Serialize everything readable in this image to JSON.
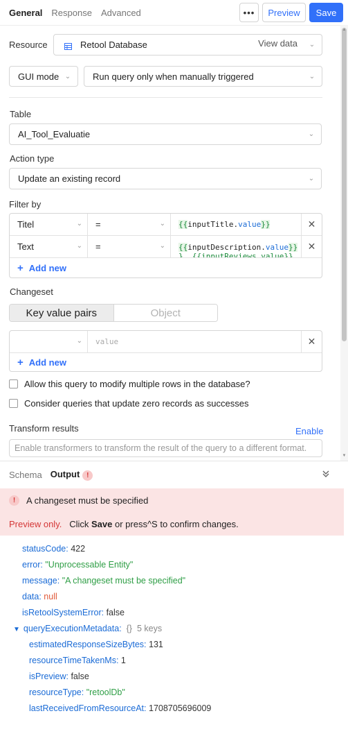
{
  "tabs": [
    "General",
    "Response",
    "Advanced"
  ],
  "toolbar": {
    "more": "•••",
    "preview": "Preview",
    "save": "Save"
  },
  "resource": {
    "label": "Resource",
    "value": "Retool Database",
    "view_data": "View data",
    "icon": "table-icon"
  },
  "mode": {
    "value": "GUI mode",
    "trigger": "Run query only when manually triggered"
  },
  "table": {
    "label": "Table",
    "value": "AI_Tool_Evaluatie"
  },
  "action": {
    "label": "Action type",
    "value": "Update an existing record"
  },
  "filter": {
    "label": "Filter by",
    "rows": [
      {
        "column": "Titel",
        "operator": "=",
        "open": "{{",
        "var": "inputTitle",
        "dot": ".",
        "prop": "value",
        "close": "}}"
      },
      {
        "column": "Text",
        "operator": "=",
        "open": "{{",
        "var": "inputDescription",
        "dot": ".",
        "prop": "value",
        "close": "}}",
        "line2": "}, {{inputReviews.value}}"
      }
    ],
    "add_new": "Add new"
  },
  "changeset": {
    "label": "Changeset",
    "segments": [
      "Key value pairs",
      "Object"
    ],
    "value_placeholder": "value",
    "add_new": "Add new"
  },
  "options": [
    "Allow this query to modify multiple rows in the database?",
    "Consider queries that update zero records as successes"
  ],
  "transform": {
    "label": "Transform results",
    "enable": "Enable",
    "placeholder": "Enable transformers to transform the result of the query to a different format."
  },
  "output": {
    "tabs": [
      "Schema",
      "Output"
    ],
    "error_badge": "!",
    "error_message": "A changeset must be specified",
    "preview": {
      "prefix": "Preview only.",
      "click": "Click",
      "save": "Save",
      "suffix": "or press^S to confirm changes."
    },
    "json": {
      "statusCode": {
        "key": "statusCode:",
        "value": "422"
      },
      "error": {
        "key": "error:",
        "value": "\"Unprocessable Entity\""
      },
      "message": {
        "key": "message:",
        "value": "\"A changeset must be specified\""
      },
      "data": {
        "key": "data:",
        "value": "null"
      },
      "isRetoolSystemError": {
        "key": "isRetoolSystemError:",
        "value": "false"
      },
      "meta": {
        "key": "queryExecutionMetadata:",
        "summary": "{}",
        "count": "5 keys",
        "items": [
          {
            "key": "estimatedResponseSizeBytes:",
            "value": "131"
          },
          {
            "key": "resourceTimeTakenMs:",
            "value": "1"
          },
          {
            "key": "isPreview:",
            "value": "false"
          },
          {
            "key": "resourceType:",
            "value": "\"retoolDb\""
          },
          {
            "key": "lastReceivedFromResourceAt:",
            "value": "1708705696009"
          }
        ]
      }
    }
  }
}
